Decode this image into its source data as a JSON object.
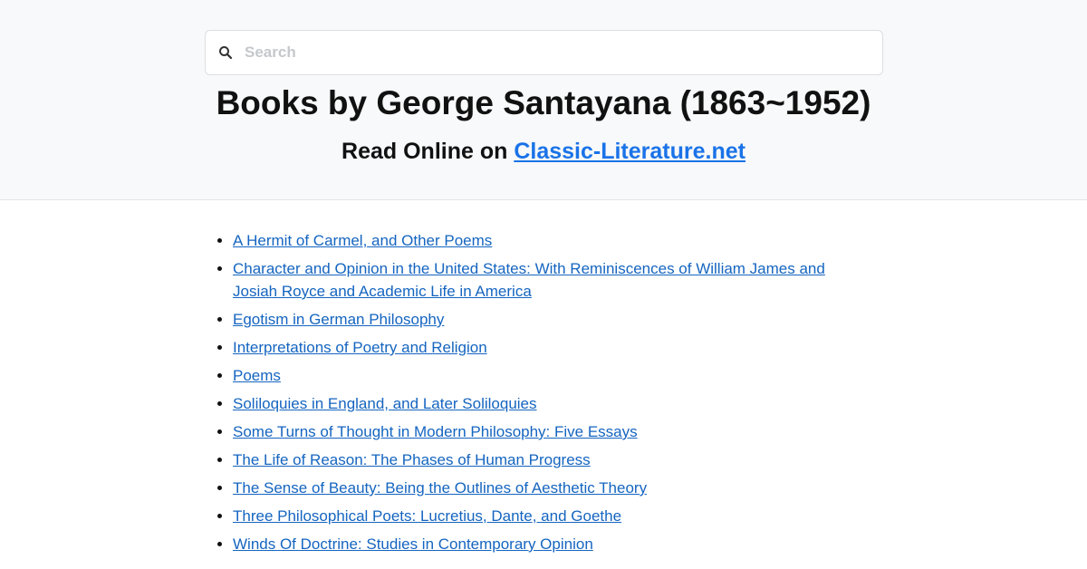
{
  "search": {
    "placeholder": "Search",
    "value": ""
  },
  "header": {
    "title": "Books by George Santayana (1863~1952)",
    "subtitle_prefix": "Read Online on ",
    "site_link": "Classic-Literature.net"
  },
  "books": [
    "A Hermit of Carmel, and Other Poems",
    "Character and Opinion in the United States: With Reminiscences of William James and Josiah Royce and Academic Life in America",
    "Egotism in German Philosophy",
    "Interpretations of Poetry and Religion",
    "Poems",
    "Soliloquies in England, and Later Soliloquies",
    "Some Turns of Thought in Modern Philosophy: Five Essays",
    "The Life of Reason: The Phases of Human Progress",
    "The Sense of Beauty: Being the Outlines of Aesthetic Theory",
    "Three Philosophical Poets: Lucretius, Dante, and Goethe",
    "Winds Of Doctrine: Studies in Contemporary Opinion"
  ],
  "colors": {
    "link": "#1565c0",
    "site_link": "#1a73e8",
    "header_bg": "#f8f9fa"
  },
  "icons": {
    "search": "search-icon"
  }
}
